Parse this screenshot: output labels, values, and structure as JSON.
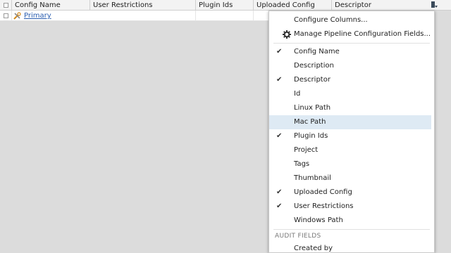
{
  "table": {
    "columns": [
      {
        "label": "Config Name"
      },
      {
        "label": "User Restrictions"
      },
      {
        "label": "Plugin Ids"
      },
      {
        "label": "Uploaded Config"
      },
      {
        "label": "Descriptor"
      }
    ],
    "rows": [
      {
        "config_name": "Primary"
      }
    ]
  },
  "icons": {
    "select_all": "checkbox-icon",
    "row_select": "checkbox-icon",
    "row_type": "tools-icon",
    "column_toggle": "column-menu-icon",
    "manage_fields": "gear-icon",
    "check": "check-icon"
  },
  "colors": {
    "link": "#2a5db0",
    "highlight": "#deeaf4",
    "background": "#dcdcdc"
  },
  "menu": {
    "configure_columns": "Configure Columns...",
    "manage_fields": "Manage Pipeline Configuration Fields...",
    "fields": [
      {
        "label": "Config Name",
        "checked": true
      },
      {
        "label": "Description",
        "checked": false
      },
      {
        "label": "Descriptor",
        "checked": true
      },
      {
        "label": "Id",
        "checked": false
      },
      {
        "label": "Linux Path",
        "checked": false
      },
      {
        "label": "Mac Path",
        "checked": false,
        "highlighted": true
      },
      {
        "label": "Plugin Ids",
        "checked": true
      },
      {
        "label": "Project",
        "checked": false
      },
      {
        "label": "Tags",
        "checked": false
      },
      {
        "label": "Thumbnail",
        "checked": false
      },
      {
        "label": "Uploaded Config",
        "checked": true
      },
      {
        "label": "User Restrictions",
        "checked": true
      },
      {
        "label": "Windows Path",
        "checked": false
      }
    ],
    "audit_section_label": "AUDIT FIELDS",
    "audit_fields": [
      {
        "label": "Created by",
        "checked": false
      }
    ]
  }
}
